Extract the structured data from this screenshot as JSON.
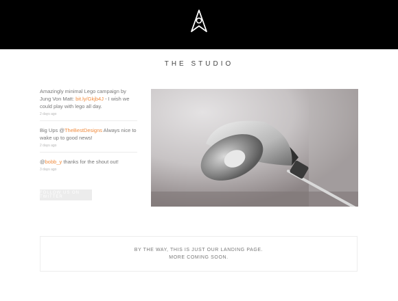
{
  "header": {
    "logo_icon": "tent-pin-logo-icon"
  },
  "section": {
    "title": "THE STUDIO"
  },
  "tweets": [
    {
      "before": "Amazingly minimal Lego campaign by Jung Von Matt: ",
      "link": "bit.ly/Gkjb4J",
      "after": " - I wish we could play with lego all day.",
      "time": "2 days ago"
    },
    {
      "before": "Big Ups @",
      "link": "TheBestDesigns",
      "after": " Always nice to wake up to good news!",
      "time": "2 days ago"
    },
    {
      "before": "@",
      "link": "bobb_y",
      "after": " thanks for the shout out!",
      "time": "3 days ago"
    }
  ],
  "follow_button": "FOLLOW US ON TWITTER",
  "photo": {
    "subject": "desk-lamp-photo"
  },
  "landing": {
    "line1": "BY THE WAY, THIS IS JUST OUR LANDING PAGE.",
    "line2": "MORE COMING SOON."
  },
  "colors": {
    "link": "#f08a3c",
    "header_bg": "#000000"
  }
}
